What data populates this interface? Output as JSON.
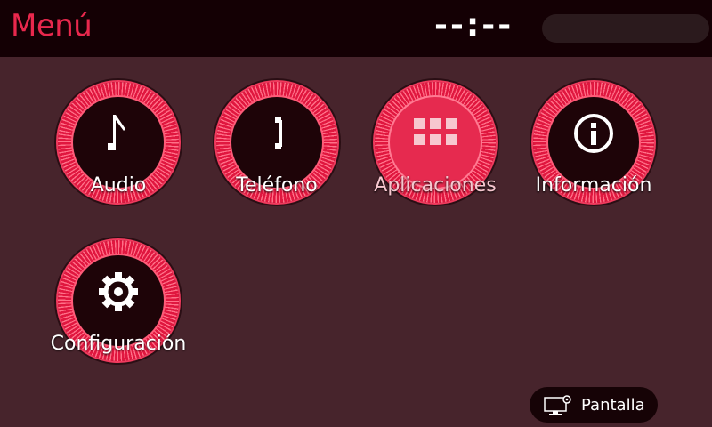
{
  "header": {
    "title": "Menú",
    "clock": "--:--"
  },
  "menu": {
    "items": [
      {
        "label": "Audio",
        "icon": "music-note-icon"
      },
      {
        "label": "Teléfono",
        "icon": "phone-handset-icon"
      },
      {
        "label": "Aplicaciones",
        "icon": "apps-grid-icon",
        "selected": true
      },
      {
        "label": "Información",
        "icon": "info-icon"
      },
      {
        "label": "Configuración",
        "icon": "gear-icon"
      }
    ]
  },
  "footer": {
    "display_button_label": "Pantalla",
    "display_button_icon": "display-settings-icon"
  },
  "colors": {
    "background": "#47242c",
    "header": "#140004",
    "accent": "#e8284d",
    "ring": "#e0173f"
  }
}
